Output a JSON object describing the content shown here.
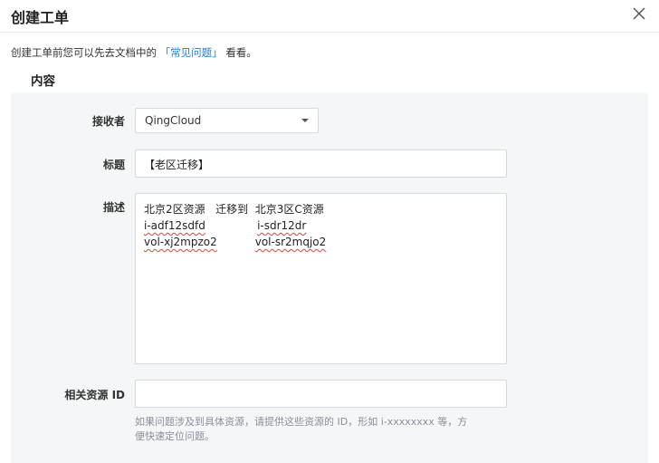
{
  "dialog": {
    "title": "创建工单",
    "close_icon": "close-icon"
  },
  "hint": {
    "prefix": "创建工单前您可以先去文档中的",
    "link": "「常见问题」",
    "suffix": "看看。"
  },
  "section": {
    "title": "内容"
  },
  "form": {
    "receiver": {
      "label": "接收者",
      "value": "QingCloud"
    },
    "title": {
      "label": "标题",
      "value": "【老区迁移】"
    },
    "description": {
      "label": "描述",
      "lines": [
        [
          "北京2区资源",
          "   迁移到",
          "  北京3区C资源"
        ],
        [
          "i-adf12sdfd",
          "i-sdr12dr"
        ],
        [
          "vol-xj2mpzo2",
          "vol-sr2mqjo2"
        ]
      ]
    },
    "resource_id": {
      "label": "相关资源 ID",
      "value": "",
      "help": "如果问题涉及到具体资源，请提供这些资源的 ID，形如 i-xxxxxxxx 等，方便快速定位问题。"
    }
  },
  "colors": {
    "link": "#1f7ad6",
    "panel_bg": "#f5f6f8",
    "spell_error": "#d64545"
  }
}
